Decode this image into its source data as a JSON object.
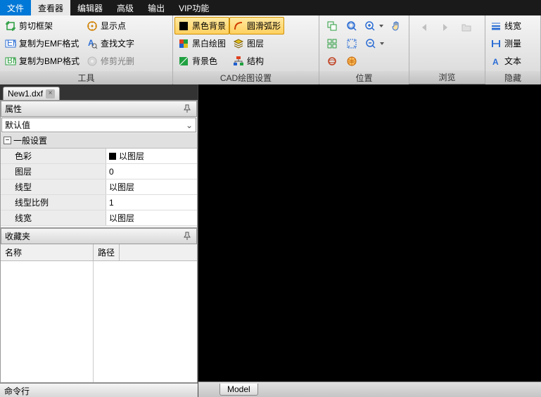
{
  "menu": {
    "items": [
      "文件",
      "查看器",
      "编辑器",
      "高级",
      "输出",
      "VIP功能"
    ],
    "active_index": 0,
    "selected_index": 1
  },
  "ribbon": {
    "groups": [
      {
        "label": "工具",
        "items": [
          {
            "icon": "crop",
            "label": "剪切框架",
            "color": "#2a9d3e"
          },
          {
            "icon": "emf",
            "label": "复制为EMF格式",
            "color": "#2a6cd4"
          },
          {
            "icon": "bmp",
            "label": "复制为BMP格式",
            "color": "#2a9d3e"
          },
          {
            "icon": "point",
            "label": "显示点",
            "color": "#d08000"
          },
          {
            "icon": "text",
            "label": "查找文字",
            "color": "#2a6cd4"
          },
          {
            "icon": "cd",
            "label": "修剪光删",
            "color": "#888",
            "disabled": true
          }
        ]
      },
      {
        "label": "CAD绘图设置",
        "items": [
          {
            "icon": "blackbg",
            "label": "黑色背景",
            "highlighted": true
          },
          {
            "icon": "bwplot",
            "label": "黑白绘图"
          },
          {
            "icon": "bgcolor",
            "label": "背景色"
          },
          {
            "icon": "arc",
            "label": "圆滑弧形",
            "highlighted": true
          },
          {
            "icon": "layers",
            "label": "图层"
          },
          {
            "icon": "struct",
            "label": "结构"
          }
        ]
      },
      {
        "label": "位置",
        "icons": [
          {
            "name": "win-duplicate",
            "color": "#2a9d3e"
          },
          {
            "name": "zoom-all",
            "color": "#2a6cd4"
          },
          {
            "name": "zoom-in",
            "color": "#2a6cd4",
            "dd": true
          },
          {
            "name": "pan",
            "color": "#2a6cd4"
          },
          {
            "name": "win-tile",
            "color": "#2a9d3e"
          },
          {
            "name": "fit",
            "color": "#2a6cd4"
          },
          {
            "name": "zoom-out",
            "color": "#2a6cd4",
            "dd": true
          },
          {
            "name": "orbit",
            "color": "#c04020"
          },
          {
            "name": "globe",
            "color": "#e06000"
          }
        ]
      },
      {
        "label": "浏览",
        "icons": [
          {
            "name": "nav-back",
            "disabled": true
          },
          {
            "name": "nav-fwd",
            "disabled": true
          },
          {
            "name": "open-file",
            "disabled": true
          }
        ]
      },
      {
        "label": "隐藏",
        "items": [
          {
            "icon": "lw",
            "label": "线宽",
            "color": "#2a6cd4"
          },
          {
            "icon": "measure",
            "label": "测量",
            "color": "#2a6cd4"
          },
          {
            "icon": "textA",
            "label": "文本",
            "color": "#2a6cd4"
          }
        ]
      }
    ]
  },
  "filetab": {
    "name": "New1.dxf"
  },
  "properties": {
    "title": "属性",
    "default_combo": "默认值",
    "category": "一般设置",
    "rows": [
      {
        "k": "色彩",
        "v": "以图层",
        "swatch": true
      },
      {
        "k": "图层",
        "v": "0"
      },
      {
        "k": "线型",
        "v": "以图层"
      },
      {
        "k": "线型比例",
        "v": "1"
      },
      {
        "k": "线宽",
        "v": "以图层"
      }
    ]
  },
  "favorites": {
    "title": "收藏夹",
    "col_name": "名称",
    "col_path": "路径"
  },
  "model_tab": "Model",
  "commandline": "命令行"
}
